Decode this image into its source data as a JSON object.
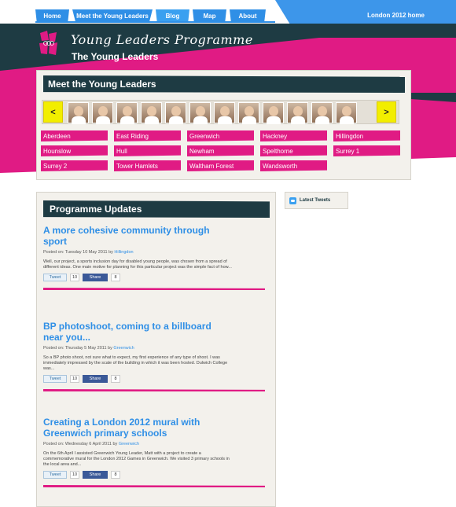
{
  "nav": {
    "items": [
      {
        "label": "Home"
      },
      {
        "label": "Meet the Young Leaders"
      },
      {
        "label": "Blog"
      },
      {
        "label": "Map"
      },
      {
        "label": "About"
      }
    ],
    "home_link": "London 2012 home"
  },
  "header": {
    "brand": "Young Leaders Programme",
    "subtitle": "The Young Leaders"
  },
  "meet": {
    "title": "Meet the Young Leaders",
    "prev": "<",
    "next": ">",
    "locations": [
      "Aberdeen",
      "East Riding",
      "Greenwich",
      "Hackney",
      "Hillingdon",
      "Hounslow",
      "Hull",
      "Newham",
      "Spelthorne",
      "Surrey 1",
      "Surrey 2",
      "Tower Hamlets",
      "Waltham Forest",
      "Wandsworth"
    ]
  },
  "updates": {
    "title": "Programme Updates",
    "posts": [
      {
        "title": "A more cohesive community through sport",
        "meta_prefix": "Posted on: Tuesday 10 May 2011 by ",
        "author": "Hillingdon",
        "body": "Well, our project, a sports inclusion day for disabled young people, was chosen from a spread of different ideas. One main motive for planning for this particular project was the simple fact of how...",
        "tweet_label": "Tweet",
        "tweet_count": "10",
        "share_label": "Share",
        "share_count": "8"
      },
      {
        "title": "BP photoshoot, coming to a billboard near you...",
        "meta_prefix": "Posted on: Thursday 5 May 2011 by ",
        "author": "Greenwich",
        "body": "So a BP photo shoot, not sure what to expect, my first experience of any type of shoot. I was immediately impressed by the scale of the building in which it was been hosted. Dulwich College was...",
        "tweet_label": "Tweet",
        "tweet_count": "10",
        "share_label": "Share",
        "share_count": "8"
      },
      {
        "title": "Creating a London 2012 mural with Greenwich primary schools",
        "meta_prefix": "Posted on: Wednesday 6 April 2011 by ",
        "author": "Greenwich",
        "body": "On the 6th April I assisted Greenwich Young Leader, Matt with a project to create a commemorative mural for the London 2012 Games in Greenwich. We visited 3 primary schools in the local area and...",
        "tweet_label": "Tweet",
        "tweet_count": "10",
        "share_label": "Share",
        "share_count": "8"
      }
    ]
  },
  "tweets": {
    "title": "Latest Tweets"
  },
  "colors": {
    "navy": "#1e3b43",
    "magenta": "#e01b84",
    "blue": "#2f8fe6",
    "yellow": "#f2ee00"
  }
}
